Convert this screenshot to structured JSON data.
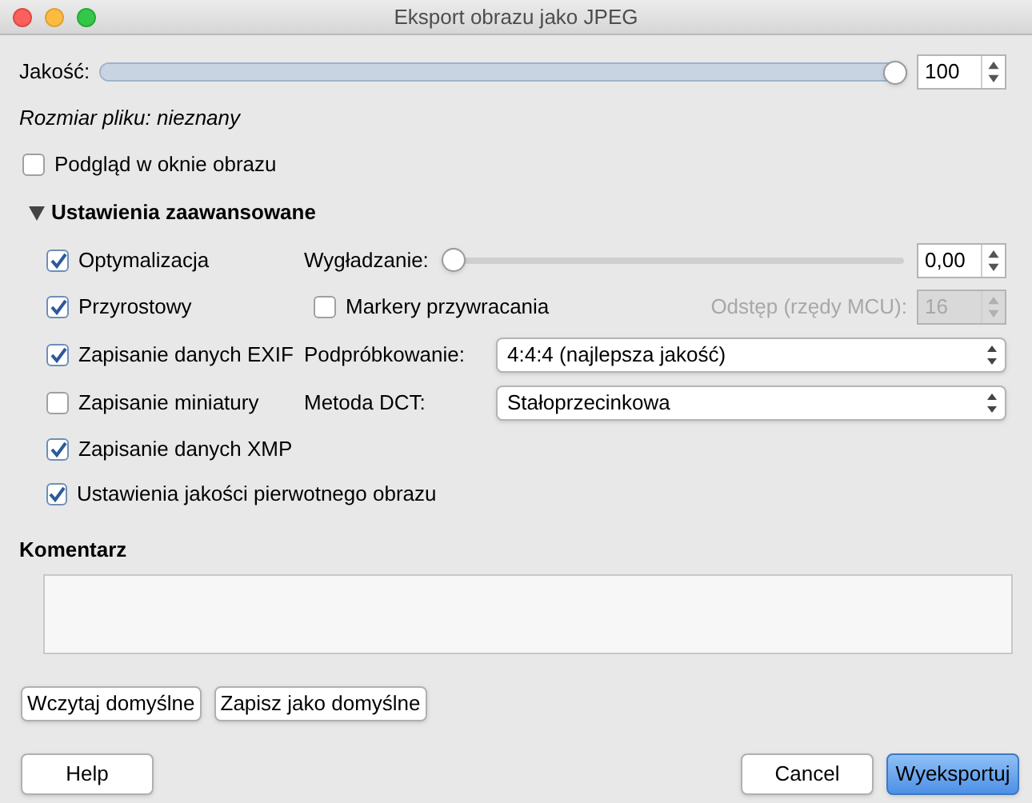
{
  "window": {
    "title": "Eksport obrazu jako JPEG"
  },
  "quality": {
    "label": "Jakość:",
    "level": 1,
    "value": "100"
  },
  "file_size": "Rozmiar pliku: nieznany",
  "preview": {
    "label": "Podgląd w oknie obrazu",
    "checked": false
  },
  "advanced": {
    "label": "Ustawienia zaawansowane",
    "expanded": true,
    "options": [
      {
        "label": "Optymalizacja",
        "checked": true
      },
      {
        "label": "Przyrostowy",
        "checked": true
      },
      {
        "label": "Zapisanie danych EXIF",
        "checked": true
      },
      {
        "label": "Zapisanie miniatury",
        "checked": false
      },
      {
        "label": "Zapisanie danych XMP",
        "checked": true
      },
      {
        "label": "Ustawienia jakości pierwotnego obrazu",
        "checked": true
      }
    ],
    "smoothing": {
      "label": "Wygładzanie:",
      "level": 0,
      "value": "0,00"
    },
    "restart_markers": {
      "label": "Markery przywracania",
      "checked": false
    },
    "interval": {
      "label": "Odstęp (rzędy MCU):",
      "value": "16",
      "disabled": true
    },
    "subsampling": {
      "label": "Podpróbkowanie:",
      "value": "4:4:4 (najlepsza jakość)"
    },
    "dct": {
      "label": "Metoda DCT:",
      "value": "Stałoprzecinkowa"
    }
  },
  "comment": {
    "label": "Komentarz"
  },
  "defaults_buttons": [
    {
      "label": "Wczytaj domyślne"
    },
    {
      "label": "Zapisz jako domyślne"
    }
  ],
  "footer_buttons": [
    {
      "label": "Help",
      "primary": false
    },
    {
      "label": "Cancel",
      "primary": false
    },
    {
      "label": "Wyeksportuj",
      "primary": true
    }
  ]
}
